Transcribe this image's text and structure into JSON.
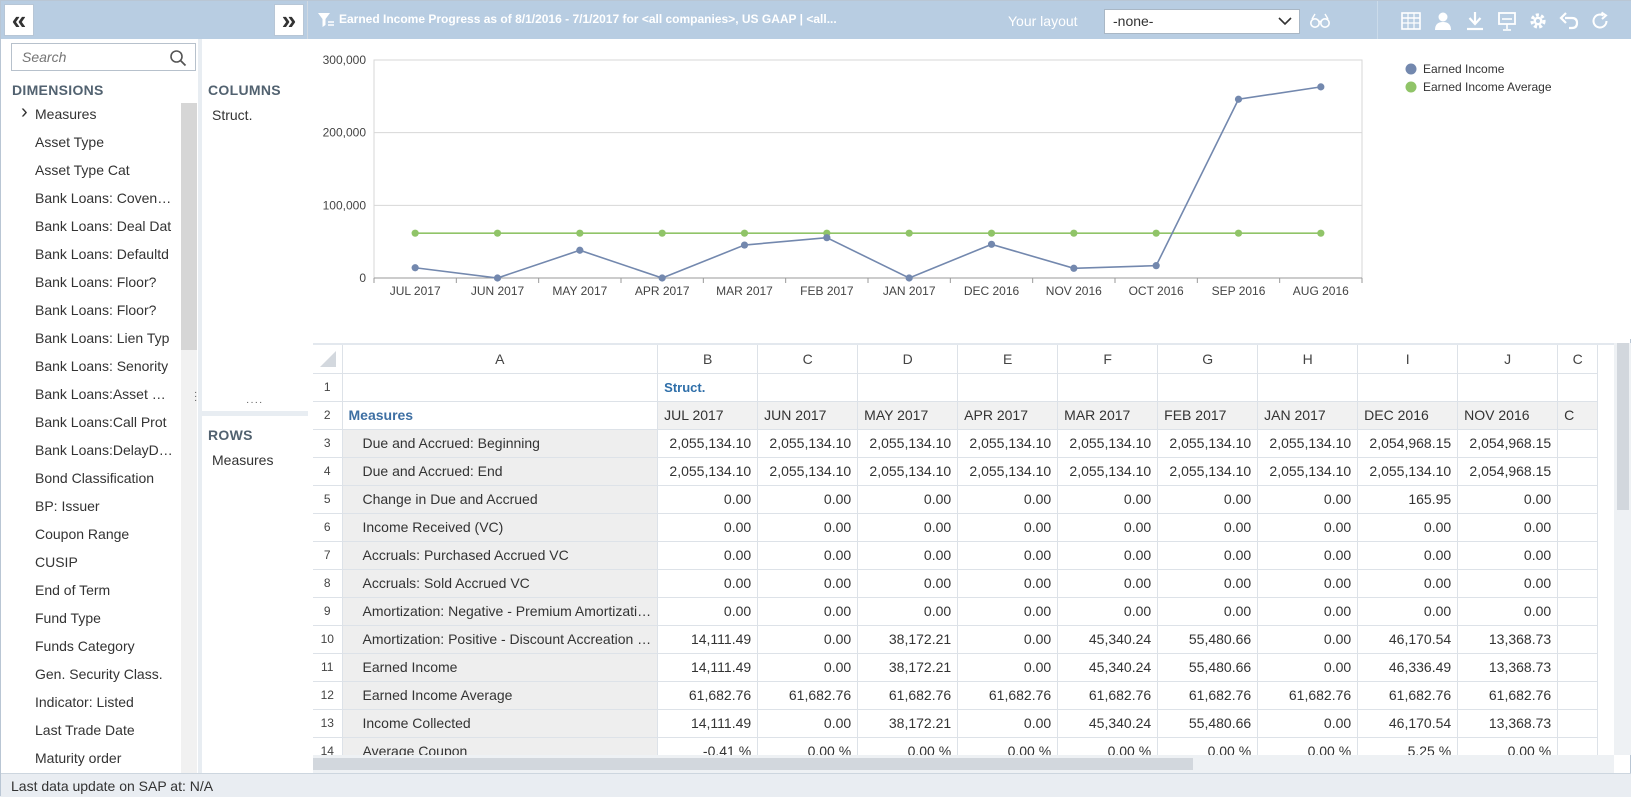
{
  "topbar": {
    "report_title": "Earned Income Progress as of 8/1/2016 - 7/1/2017 for <all companies>, US GAAP | <all...",
    "layout_label": "Your layout",
    "layout_value": "-none-"
  },
  "left": {
    "search_placeholder": "Search",
    "dimensions_title": "DIMENSIONS",
    "dimensions": [
      "Measures",
      "Asset Type",
      "Asset Type Cat",
      "Bank Loans: Coven…",
      "Bank Loans: Deal Dat",
      "Bank Loans: Defaultd",
      "Bank Loans: Floor?",
      "Bank Loans: Floor?",
      "Bank Loans: Lien Typ",
      "Bank Loans: Senority",
      "Bank Loans:Asset …",
      "Bank Loans:Call Prot",
      "Bank Loans:DelayD…",
      "Bond Classification",
      "BP: Issuer",
      "Coupon Range",
      "CUSIP",
      "End of Term",
      "Fund Type",
      "Funds Category",
      "Gen. Security Class.",
      "Indicator: Listed",
      "Last Trade Date",
      "Maturity order"
    ],
    "columns_title": "COLUMNS",
    "columns_item": "Struct.",
    "rows_title": "ROWS",
    "rows_item": "Measures"
  },
  "chart_data": {
    "type": "line",
    "categories": [
      "JUL 2017",
      "JUN 2017",
      "MAY 2017",
      "APR 2017",
      "MAR 2017",
      "FEB 2017",
      "JAN 2017",
      "DEC 2016",
      "NOV 2016",
      "OCT 2016",
      "SEP 2016",
      "AUG 2016"
    ],
    "series": [
      {
        "name": "Earned Income",
        "color": "#7388ae",
        "values": [
          14111.49,
          0,
          38172.21,
          0,
          45340.24,
          55480.66,
          0,
          46336.49,
          13368.73,
          17000,
          246000,
          263000
        ]
      },
      {
        "name": "Earned Income Average",
        "color": "#90c468",
        "values": [
          61682.76,
          61682.76,
          61682.76,
          61682.76,
          61682.76,
          61682.76,
          61682.76,
          61682.76,
          61682.76,
          61682.76,
          61682.76,
          61682.76
        ]
      }
    ],
    "ylim": [
      0,
      300000
    ],
    "yticks": [
      "0",
      "100,000",
      "200,000",
      "300,000"
    ],
    "grid": true,
    "legend": "top-right"
  },
  "grid": {
    "col_letters": [
      "A",
      "B",
      "C",
      "D",
      "E",
      "F",
      "G",
      "H",
      "I",
      "J",
      "C"
    ],
    "row1_struct": "Struct.",
    "row2_measures": "Measures",
    "months": [
      "JUL 2017",
      "JUN 2017",
      "MAY 2017",
      "APR 2017",
      "MAR 2017",
      "FEB 2017",
      "JAN 2017",
      "DEC 2016",
      "NOV 2016",
      "C"
    ],
    "rows": [
      {
        "n": "3",
        "label": "Due and Accrued: Beginning",
        "values": [
          "2,055,134.10",
          "2,055,134.10",
          "2,055,134.10",
          "2,055,134.10",
          "2,055,134.10",
          "2,055,134.10",
          "2,055,134.10",
          "2,054,968.15",
          "2,054,968.15"
        ]
      },
      {
        "n": "4",
        "label": "Due and Accrued: End",
        "values": [
          "2,055,134.10",
          "2,055,134.10",
          "2,055,134.10",
          "2,055,134.10",
          "2,055,134.10",
          "2,055,134.10",
          "2,055,134.10",
          "2,055,134.10",
          "2,054,968.15"
        ]
      },
      {
        "n": "5",
        "label": "Change in Due and Accrued",
        "values": [
          "0.00",
          "0.00",
          "0.00",
          "0.00",
          "0.00",
          "0.00",
          "0.00",
          "165.95",
          "0.00"
        ]
      },
      {
        "n": "6",
        "label": "Income Received (VC)",
        "values": [
          "0.00",
          "0.00",
          "0.00",
          "0.00",
          "0.00",
          "0.00",
          "0.00",
          "0.00",
          "0.00"
        ]
      },
      {
        "n": "7",
        "label": "Accruals: Purchased Accrued VC",
        "values": [
          "0.00",
          "0.00",
          "0.00",
          "0.00",
          "0.00",
          "0.00",
          "0.00",
          "0.00",
          "0.00"
        ]
      },
      {
        "n": "8",
        "label": "Accruals: Sold Accrued VC",
        "values": [
          "0.00",
          "0.00",
          "0.00",
          "0.00",
          "0.00",
          "0.00",
          "0.00",
          "0.00",
          "0.00"
        ]
      },
      {
        "n": "9",
        "label": "Amortization: Negative - Premium Amortizati…",
        "values": [
          "0.00",
          "0.00",
          "0.00",
          "0.00",
          "0.00",
          "0.00",
          "0.00",
          "0.00",
          "0.00"
        ]
      },
      {
        "n": "10",
        "label": "Amortization: Positive - Discount Accreation …",
        "values": [
          "14,111.49",
          "0.00",
          "38,172.21",
          "0.00",
          "45,340.24",
          "55,480.66",
          "0.00",
          "46,170.54",
          "13,368.73"
        ]
      },
      {
        "n": "11",
        "label": "Earned Income",
        "values": [
          "14,111.49",
          "0.00",
          "38,172.21",
          "0.00",
          "45,340.24",
          "55,480.66",
          "0.00",
          "46,336.49",
          "13,368.73"
        ]
      },
      {
        "n": "12",
        "label": "Earned Income Average",
        "values": [
          "61,682.76",
          "61,682.76",
          "61,682.76",
          "61,682.76",
          "61,682.76",
          "61,682.76",
          "61,682.76",
          "61,682.76",
          "61,682.76"
        ]
      },
      {
        "n": "13",
        "label": "Income Collected",
        "values": [
          "14,111.49",
          "0.00",
          "38,172.21",
          "0.00",
          "45,340.24",
          "55,480.66",
          "0.00",
          "46,170.54",
          "13,368.73"
        ]
      },
      {
        "n": "14",
        "label": "Average Coupon",
        "values": [
          "-0.41 %",
          "0.00 %",
          "0.00 %",
          "0.00 %",
          "0.00 %",
          "0.00 %",
          "0.00 %",
          "5.25 %",
          "0.00 %"
        ]
      }
    ]
  },
  "icons": {
    "collapse_left": "double-chevron-left-icon",
    "collapse_right": "double-chevron-right-icon",
    "filter": "filter-icon",
    "glasses": "glasses-icon",
    "toolbar": [
      "table-icon",
      "user-icon",
      "download-icon",
      "presentation-icon",
      "gear-icon",
      "undo-icon",
      "refresh-icon"
    ]
  },
  "status": {
    "text": "Last data update on SAP at: N/A"
  }
}
